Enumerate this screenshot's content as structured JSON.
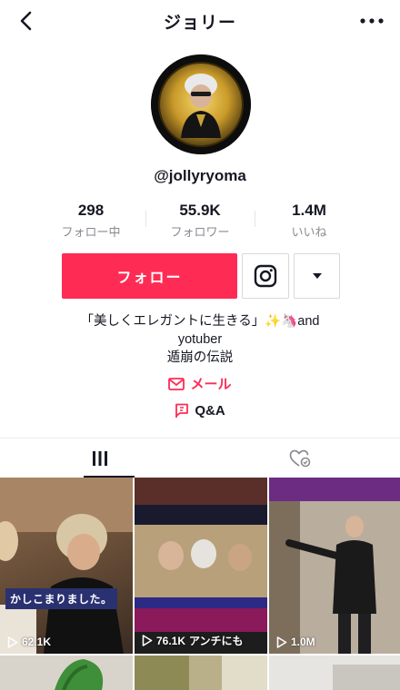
{
  "header": {
    "title": "ジョリー"
  },
  "profile": {
    "username": "@jollyryoma",
    "stats": [
      {
        "value": "298",
        "label": "フォロー中"
      },
      {
        "value": "55.9K",
        "label": "フォロワー"
      },
      {
        "value": "1.4M",
        "label": "いいね"
      }
    ],
    "follow_label": "フォロー",
    "bio": [
      "「美しくエレガントに生きる」✨🦄and",
      "yotuber",
      "遁崩の伝説"
    ],
    "mail_label": "メール",
    "qa_label": "Q&A"
  },
  "videos": [
    {
      "views": "62.1K",
      "caption": "かしこまりました。"
    },
    {
      "views": "76.1K",
      "caption": "アンチにも"
    },
    {
      "views": "1.0M",
      "caption": ""
    }
  ],
  "colors": {
    "accent": "#fe2c55",
    "text": "#161823",
    "muted": "#8a8b91"
  }
}
